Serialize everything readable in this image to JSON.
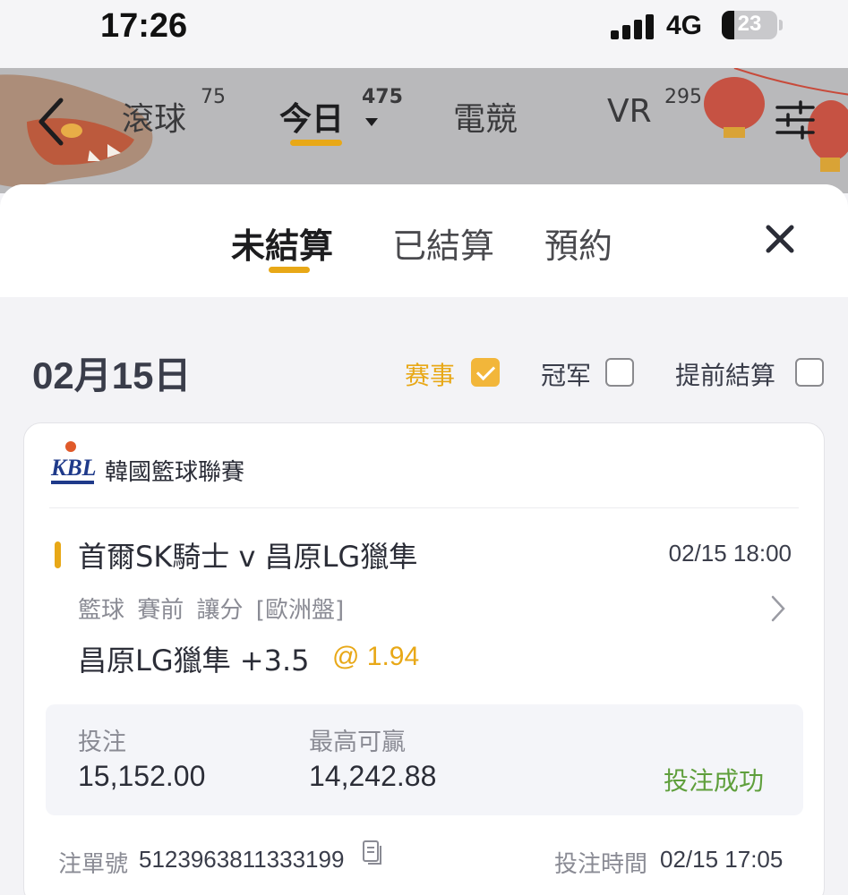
{
  "status_bar": {
    "time": "17:26",
    "network": "4G",
    "battery": "23"
  },
  "nav": {
    "tabs": [
      {
        "label": "滾球",
        "count": "75"
      },
      {
        "label": "今日",
        "count": "475"
      },
      {
        "label": "電競",
        "count": ""
      },
      {
        "label": "VR",
        "count": "295"
      }
    ],
    "active_tab": "今日"
  },
  "sheet": {
    "segments": [
      "未結算",
      "已結算",
      "預約"
    ],
    "active_segment": "未結算"
  },
  "filters": {
    "date": "02月15日",
    "options": [
      {
        "label": "赛事",
        "checked": true
      },
      {
        "label": "冠军",
        "checked": false
      },
      {
        "label": "提前結算",
        "checked": false
      }
    ]
  },
  "bet": {
    "league": "韓國籃球聯賽",
    "match": "首爾SK騎士 v 昌原LG獵隼",
    "match_time": "02/15 18:00",
    "meta": "籃球 賽前 讓分 [歐洲盤]",
    "pick": "昌原LG獵隼 +3.5",
    "odds": "@ 1.94",
    "stake_label": "投注",
    "stake": "15,152.00",
    "max_win_label": "最高可贏",
    "max_win": "14,242.88",
    "status": "投注成功",
    "ref_label": "注單號",
    "ref": "5123963811333199",
    "bet_time_label": "投注時間",
    "bet_time": "02/15 17:05"
  },
  "colors": {
    "accent": "#e8a817",
    "success": "#5f9f3c"
  }
}
